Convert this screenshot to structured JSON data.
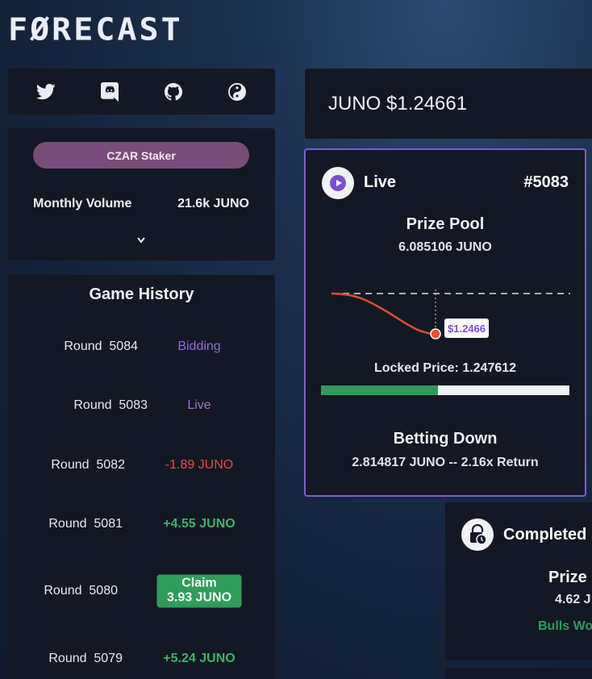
{
  "brand": {
    "logo_text": "FØRECAST"
  },
  "social": {
    "icons": [
      "twitter-icon",
      "discord-icon",
      "github-icon",
      "yin-yang-icon"
    ]
  },
  "staker": {
    "badge": "CZAR Staker",
    "volume_label": "Monthly Volume",
    "volume_value": "21.6k JUNO"
  },
  "history": {
    "title": "Game History",
    "rows": [
      {
        "round_label": "Round",
        "round": "5084",
        "status": "Bidding",
        "kind": "bidding"
      },
      {
        "round_label": "Round",
        "round": "5083",
        "status": "Live",
        "kind": "live"
      },
      {
        "round_label": "Round",
        "round": "5082",
        "status": "-1.89 JUNO",
        "kind": "loss"
      },
      {
        "round_label": "Round",
        "round": "5081",
        "status": "+4.55 JUNO",
        "kind": "win"
      },
      {
        "round_label": "Round",
        "round": "5080",
        "claim_label": "Claim",
        "claim_amount": "3.93 JUNO",
        "kind": "claim"
      },
      {
        "round_label": "Round",
        "round": "5079",
        "status": "+5.24 JUNO",
        "kind": "win"
      }
    ]
  },
  "price": {
    "text": "JUNO $1.24661"
  },
  "live_round": {
    "status": "Live",
    "round_id": "#5083",
    "pool_title": "Prize Pool",
    "pool_value": "6.085106 JUNO",
    "current_price_tag": "$1.2466",
    "locked_label": "Locked Price: 1.247612",
    "up_share": 0.47,
    "bet_title": "Betting Down",
    "bet_detail": "2.814817 JUNO --  2.16x Return",
    "colors": {
      "accent": "#7a5fc9",
      "line": "#d9502f",
      "up": "#2f9c5b"
    }
  },
  "completed_round": {
    "status": "Completed",
    "pool_title": "Prize",
    "pool_value": "4.62 J",
    "result": "Bulls Wo"
  }
}
